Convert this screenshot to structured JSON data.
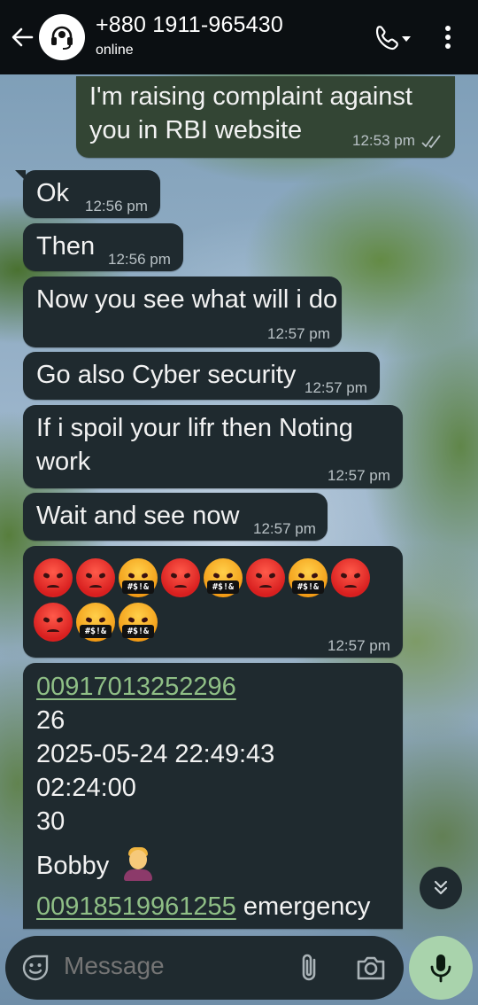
{
  "header": {
    "contact_name": "+880 1911-965430",
    "status": "online",
    "back_icon": "arrow-left-icon",
    "avatar_icon": "headset-avatar-icon",
    "call_icon": "phone-dropdown-icon",
    "menu_icon": "more-vertical-icon"
  },
  "messages": [
    {
      "direction": "out",
      "lines": [
        "I'm raising complaint against",
        "you in RBI website"
      ],
      "time": "12:53 pm",
      "status": "read"
    },
    {
      "direction": "in",
      "lines": [
        "Ok"
      ],
      "time": "12:56 pm"
    },
    {
      "direction": "in",
      "lines": [
        "Then"
      ],
      "time": "12:56 pm"
    },
    {
      "direction": "in",
      "lines": [
        "Now you see what will i do"
      ],
      "time": "12:57 pm"
    },
    {
      "direction": "in",
      "lines": [
        "Go also Cyber security"
      ],
      "time": "12:57 pm"
    },
    {
      "direction": "in",
      "lines": [
        "If i spoil your lifr then Noting",
        "work"
      ],
      "time": "12:57 pm"
    },
    {
      "direction": "in",
      "lines": [
        "Wait and see now"
      ],
      "time": "12:57 pm"
    },
    {
      "direction": "in",
      "emojis": [
        "angry-face",
        "angry-face",
        "face-with-symbols",
        "angry-face",
        "face-with-symbols",
        "angry-face",
        "face-with-symbols",
        "angry-face",
        "angry-face",
        "face-with-symbols",
        "face-with-symbols"
      ],
      "emoji_symbol_text": "#$!&",
      "time": "12:57 pm"
    },
    {
      "direction": "in",
      "card": {
        "phone_1": "00917013252296",
        "line_2": "26",
        "line_3": "2025-05-24 22:49:43",
        "line_4": "02:24:00",
        "line_5": "30",
        "name": "Bobby",
        "phone_2": "00918519961255",
        "phone_2_suffix": " emergency"
      }
    }
  ],
  "composer": {
    "placeholder": "Message",
    "emoji_icon": "emoji-smiley-icon",
    "attach_icon": "paperclip-icon",
    "camera_icon": "camera-icon",
    "mic_icon": "microphone-icon"
  },
  "scroll_icon": "double-chevron-down-icon",
  "colors": {
    "header_bg": "#0b0f12",
    "incoming_bubble": "#1f2a2f",
    "outgoing_bubble": "#334534",
    "link": "#8fbf86",
    "mic_button": "#a9d3ac"
  }
}
